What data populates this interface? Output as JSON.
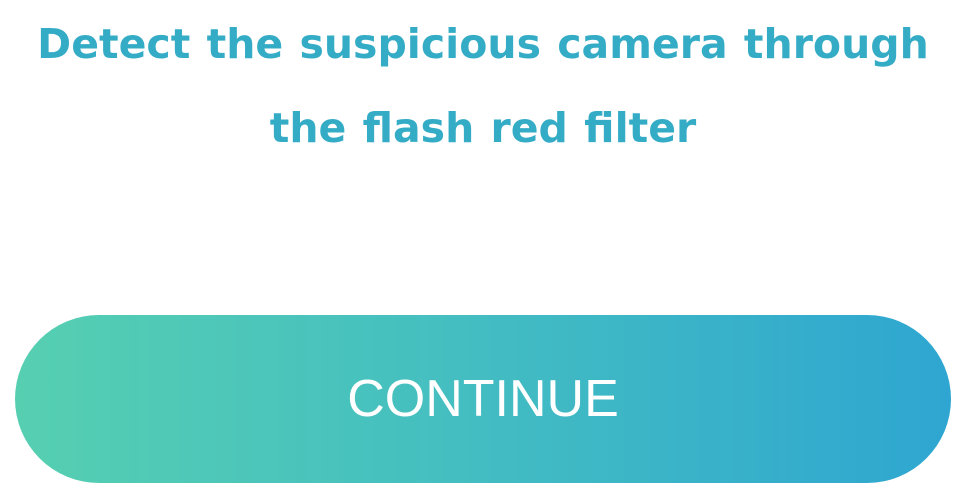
{
  "onboarding": {
    "headline": "Detect the suspicious camera through the flash red filter",
    "continue_label": "CONTINUE"
  },
  "colors": {
    "headline_text": "#35acc6",
    "button_gradient_start": "#56cfb1",
    "button_gradient_end": "#2ea6d1",
    "button_text": "#ffffff"
  }
}
